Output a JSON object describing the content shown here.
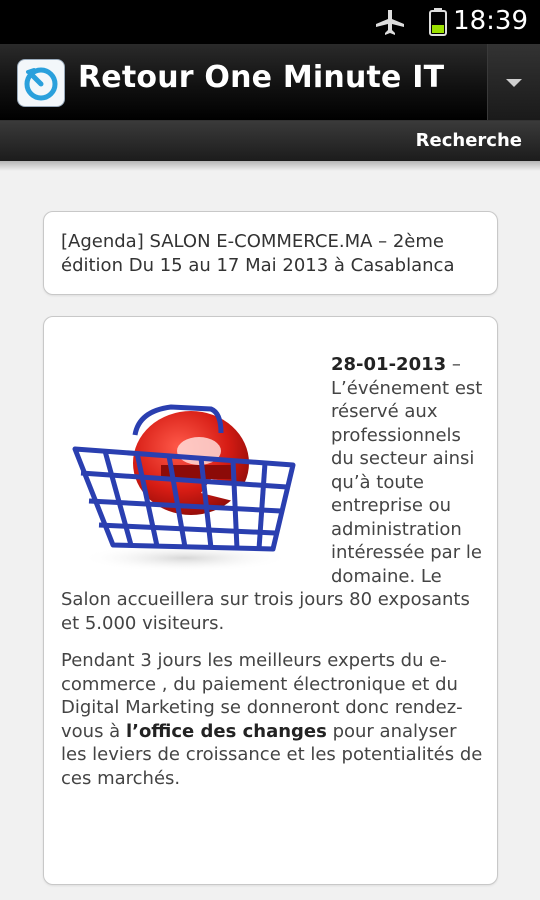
{
  "status": {
    "time": "18:39"
  },
  "header": {
    "title": "Retour One Minute IT",
    "search_label": "Recherche"
  },
  "card_title": {
    "text": "[Agenda] SALON E-COMMERCE.MA – 2ème édition Du 15 au 17 Mai 2013 à Casablanca"
  },
  "article": {
    "date": "28-01-2013",
    "p1_after_date": " – L’événement est réservé aux professionnels du secteur ainsi qu’à toute entreprise ou administration intéressée par le domaine. Le Salon accueillera sur trois jours 80 exposants et 5.000 visiteurs.",
    "p2_part1": "Pendant 3 jours les meilleurs experts du e-commerce , du paiement électronique et du Digital Marketing se donneront donc rendez-vous à ",
    "p2_bold": "l’office des changes",
    "p2_part2": " pour analyser les leviers de croissance et les potentialités de ces marchés.",
    "image_icon": "e-commerce-basket-icon"
  },
  "colors": {
    "accent_red": "#d62020",
    "basket_blue": "#2a3fb0"
  }
}
